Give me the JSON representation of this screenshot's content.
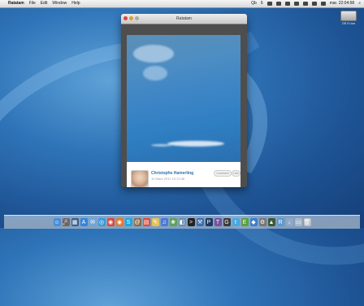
{
  "menubar": {
    "apple": "",
    "app_name": "Ratatam",
    "menus": [
      "File",
      "Edit",
      "Window",
      "Help"
    ],
    "status": {
      "qs_label": "Qb",
      "count": "6",
      "clock": "mar. 22:04:58"
    }
  },
  "desktop": {
    "drive_label": "OS X Lion"
  },
  "window": {
    "title": "Ratatam"
  },
  "photo": {
    "author": "Christophe Hamerling",
    "date": "10 Mars 2012 10:13:46",
    "comment_label": "Comment",
    "like_label": "Like"
  },
  "dock": {
    "icons": [
      {
        "name": "finder-icon",
        "color": "#4a8ed6",
        "glyph": "☺"
      },
      {
        "name": "launchpad-icon",
        "color": "#6b6b6b",
        "glyph": "🚀"
      },
      {
        "name": "mission-control-icon",
        "color": "#3a5f8a",
        "glyph": "▦"
      },
      {
        "name": "app-store-icon",
        "color": "#2e86de",
        "glyph": "A"
      },
      {
        "name": "mail-icon",
        "color": "#6fa6d9",
        "glyph": "✉"
      },
      {
        "name": "safari-icon",
        "color": "#3a9ad9",
        "glyph": "◎"
      },
      {
        "name": "chrome-icon",
        "color": "#d94a3a",
        "glyph": "◉"
      },
      {
        "name": "firefox-icon",
        "color": "#e27a2b",
        "glyph": "◉"
      },
      {
        "name": "skype-icon",
        "color": "#1fa5e0",
        "glyph": "S"
      },
      {
        "name": "contacts-icon",
        "color": "#8c6a45",
        "glyph": "@"
      },
      {
        "name": "calendar-icon",
        "color": "#e04a3a",
        "glyph": "▤"
      },
      {
        "name": "notes-icon",
        "color": "#e6c35a",
        "glyph": "✎"
      },
      {
        "name": "itunes-icon",
        "color": "#4a7bd6",
        "glyph": "♫"
      },
      {
        "name": "iphoto-icon",
        "color": "#5fa05a",
        "glyph": "❀"
      },
      {
        "name": "preview-icon",
        "color": "#6a8fb0",
        "glyph": "◧"
      },
      {
        "name": "terminal-icon",
        "color": "#222222",
        "glyph": ">"
      },
      {
        "name": "xcode-icon",
        "color": "#3e6fb0",
        "glyph": "⚒"
      },
      {
        "name": "photoshop-icon",
        "color": "#1c3a5c",
        "glyph": "P"
      },
      {
        "name": "textmate-icon",
        "color": "#7a4fa0",
        "glyph": "T"
      },
      {
        "name": "github-icon",
        "color": "#3a3a3a",
        "glyph": "G"
      },
      {
        "name": "twitter-icon",
        "color": "#4aa8e0",
        "glyph": "t"
      },
      {
        "name": "evernote-icon",
        "color": "#5aa040",
        "glyph": "E"
      },
      {
        "name": "dropbox-icon",
        "color": "#3a80d0",
        "glyph": "◆"
      },
      {
        "name": "system-preferences-icon",
        "color": "#777777",
        "glyph": "⚙"
      },
      {
        "name": "activity-monitor-icon",
        "color": "#3a5a3a",
        "glyph": "▲"
      },
      {
        "name": "ratatam-icon",
        "color": "#5a9ad0",
        "glyph": "R"
      },
      {
        "name": "downloads-stack-icon",
        "color": "#8fa8c8",
        "glyph": "↓"
      },
      {
        "name": "documents-stack-icon",
        "color": "#a8b8c8",
        "glyph": "▭"
      },
      {
        "name": "trash-icon",
        "color": "#b8c0c8",
        "glyph": "🗑"
      }
    ]
  }
}
